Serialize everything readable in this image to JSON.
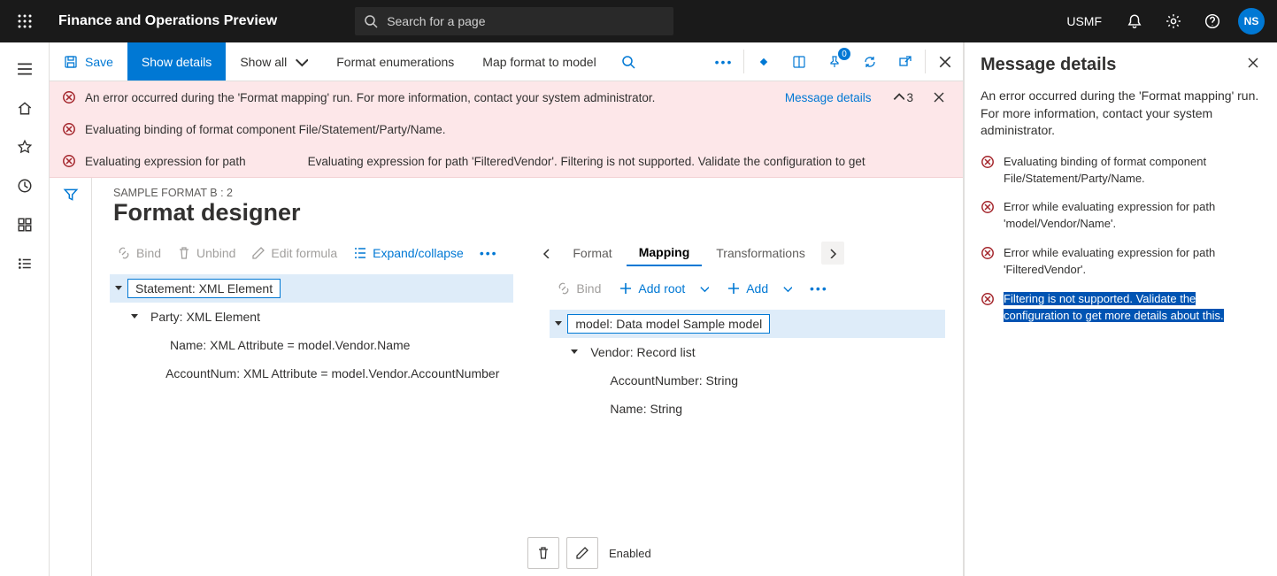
{
  "topbar": {
    "app_title": "Finance and Operations Preview",
    "search_placeholder": "Search for a page",
    "company": "USMF",
    "avatar": "NS"
  },
  "actionbar": {
    "save": "Save",
    "show_details": "Show details",
    "show_all": "Show all",
    "format_enum": "Format enumerations",
    "map_format": "Map format to model",
    "pin_badge": "0"
  },
  "errors": {
    "row1": "An error occurred during the 'Format mapping' run. For more information, contact your system administrator.",
    "details_link": "Message details",
    "count": "3",
    "row2": "Evaluating binding of format component File/Statement/Party/Name.",
    "row3a": "Evaluating expression for path",
    "row3b": "Evaluating expression for path 'FilteredVendor'. Filtering is not supported. Validate the configuration to get"
  },
  "page": {
    "breadcrumb": "SAMPLE FORMAT B : 2",
    "title": "Format designer"
  },
  "left_tools": {
    "bind": "Bind",
    "unbind": "Unbind",
    "edit": "Edit formula",
    "expand": "Expand/collapse"
  },
  "left_tree": {
    "n0": "Statement: XML Element",
    "n1": "Party: XML Element",
    "n2": "Name: XML Attribute = model.Vendor.Name",
    "n3": "AccountNum: XML Attribute = model.Vendor.AccountNumber"
  },
  "tabs": {
    "format": "Format",
    "mapping": "Mapping",
    "trans": "Transformations"
  },
  "right_tools": {
    "bind": "Bind",
    "addroot": "Add root",
    "add": "Add"
  },
  "right_tree": {
    "n0": "model: Data model Sample model",
    "n1": "Vendor: Record list",
    "n2": "AccountNumber: String",
    "n3": "Name: String"
  },
  "bottom": {
    "enabled": "Enabled"
  },
  "panel": {
    "title": "Message details",
    "summary": "An error occurred during the 'Format mapping' run. For more information, contact your system administrator.",
    "i0": "Evaluating binding of format component File/Statement/Party/Name.",
    "i1": "Error while evaluating expression for path 'model/Vendor/Name'.",
    "i2": "Error while evaluating expression for path 'FilteredVendor'.",
    "i3": "Filtering is not supported. Validate the configuration to get more details about this."
  }
}
